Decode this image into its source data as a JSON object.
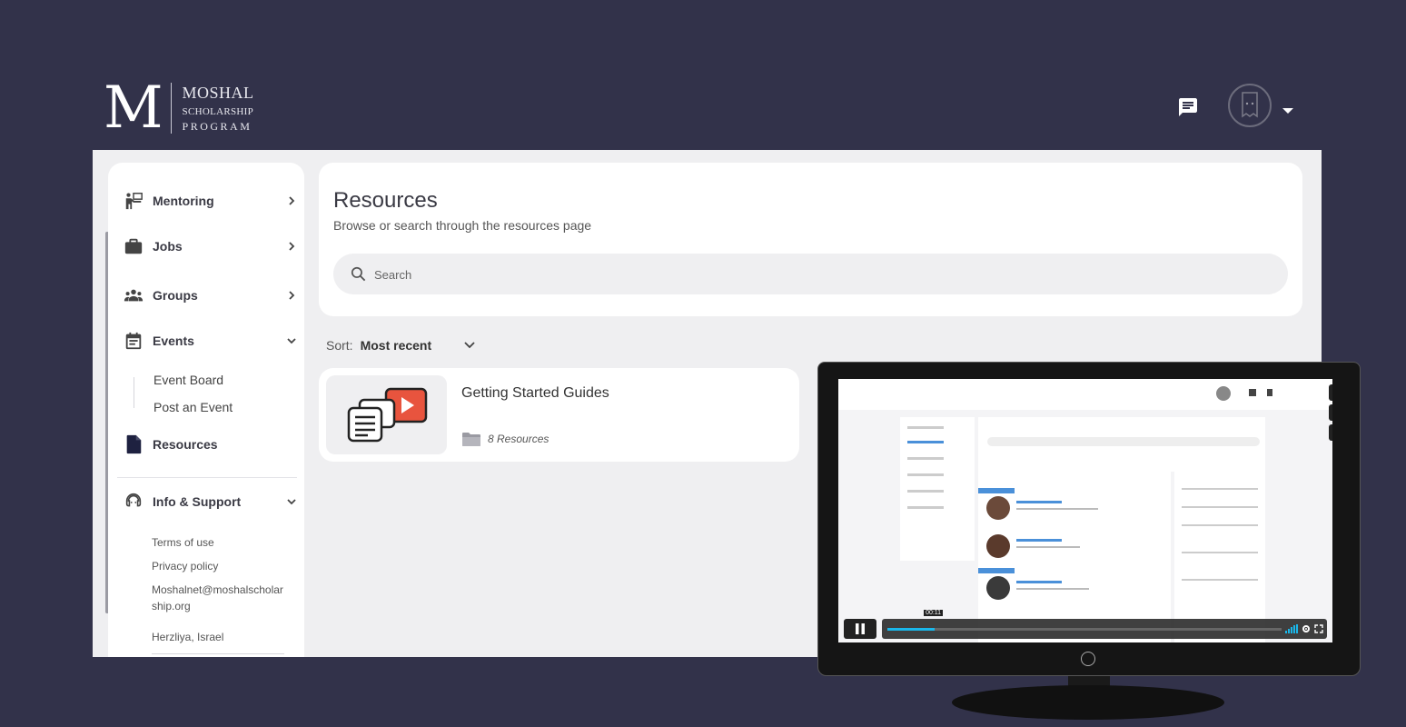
{
  "brand": {
    "mark": "M",
    "line1": "MOSHAL",
    "line2": "SCHOLARSHIP",
    "line3": "PROGRAM"
  },
  "header": {
    "chat_icon": "chat-icon",
    "avatar_icon": "avatar-icon"
  },
  "sidebar": {
    "items": [
      {
        "label": "Mentoring",
        "icon": "mentoring-icon"
      },
      {
        "label": "Jobs",
        "icon": "briefcase-icon"
      },
      {
        "label": "Groups",
        "icon": "groups-icon"
      },
      {
        "label": "Events",
        "icon": "calendar-icon"
      },
      {
        "label": "Resources",
        "icon": "document-icon"
      },
      {
        "label": "Info & Support",
        "icon": "support-icon"
      }
    ],
    "events_sub": [
      "Event Board",
      "Post an Event"
    ],
    "info": {
      "terms": "Terms of use",
      "privacy": "Privacy policy",
      "email": "Moshalnet@moshalscholarship.org",
      "location": "Herzliya, Israel"
    }
  },
  "resources": {
    "title": "Resources",
    "subtitle": "Browse or search through the resources page",
    "search_placeholder": "Search"
  },
  "sort": {
    "label": "Sort:",
    "value": "Most recent"
  },
  "cards": [
    {
      "title": "Getting Started Guides",
      "count": "8 Resources"
    }
  ],
  "video": {
    "progress": 0.12,
    "time": "00:11"
  },
  "colors": {
    "background": "#32324a",
    "panel": "#efeff1",
    "accent_video": "#e8543e",
    "progress": "#1ab7ea"
  }
}
